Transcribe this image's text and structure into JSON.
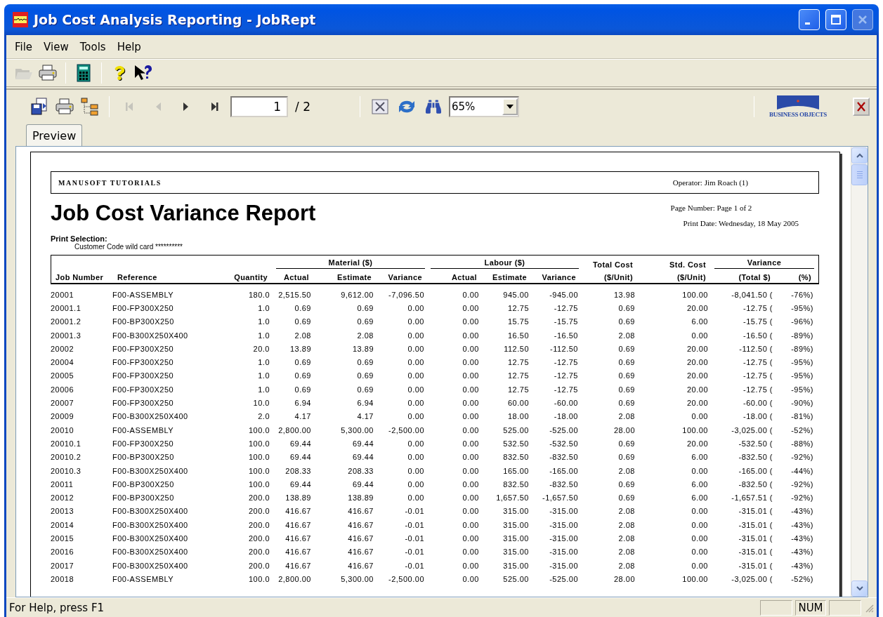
{
  "window": {
    "title": "Job Cost Analysis Reporting - JobRept",
    "controls": [
      {
        "kind": "minimize",
        "disabled": false
      },
      {
        "kind": "maximize",
        "disabled": false
      },
      {
        "kind": "close",
        "disabled": true
      }
    ]
  },
  "menu": [
    "File",
    "View",
    "Tools",
    "Help"
  ],
  "toolbar": [
    [
      {
        "kind": "open",
        "disabled": true
      },
      {
        "kind": "print",
        "disabled": false
      }
    ],
    [
      {
        "kind": "calculator",
        "disabled": false
      }
    ],
    [
      {
        "kind": "help",
        "disabled": false
      },
      {
        "kind": "context_help",
        "disabled": false
      }
    ]
  ],
  "report_toolbar": {
    "tools": [
      {
        "kind": "export",
        "disabled": false
      },
      {
        "kind": "print",
        "disabled": false
      },
      {
        "kind": "group_tree",
        "disabled": false
      }
    ],
    "navigation": [
      {
        "kind": "first",
        "disabled": true
      },
      {
        "kind": "prev",
        "disabled": true
      },
      {
        "kind": "next",
        "disabled": false
      },
      {
        "kind": "last",
        "disabled": false
      }
    ],
    "page_field": {
      "value": "1"
    },
    "page_total": "/ 2",
    "actions": [
      {
        "kind": "stop",
        "disabled": false
      },
      {
        "kind": "refresh",
        "disabled": false
      },
      {
        "kind": "search",
        "disabled": false
      }
    ],
    "zoom": {
      "value": "65%"
    },
    "logo_text": "BUSINESS OBJECTS"
  },
  "tabs": [
    {
      "label": "Preview",
      "selected": true
    }
  ],
  "report": {
    "company": "MANUSOFT TUTORIALS",
    "operator": "Operator: Jim Roach (1)",
    "title": "Job Cost Variance Report",
    "page_number": "Page Number: Page 1 of 2",
    "print_date": "Print Date: Wednesday, 18 May 2005",
    "print_selection_label": "Print Selection:",
    "print_selection": "Customer Code wild card **********",
    "header_groups": [
      {
        "kind": "single",
        "columns": [
          "Job Number"
        ]
      },
      {
        "kind": "single",
        "columns": [
          "Reference"
        ]
      },
      {
        "kind": "single",
        "columns": [
          "Quantity"
        ]
      },
      {
        "kind": "group",
        "label": "Material ($)",
        "columns": [
          "Actual",
          "Estimate",
          "Variance"
        ]
      },
      {
        "kind": "group",
        "label": "Labour ($)",
        "columns": [
          "Actual",
          "Estimate",
          "Variance"
        ]
      },
      {
        "kind": "stacked",
        "label": "Total Cost",
        "columns": [
          "($/Unit)"
        ]
      },
      {
        "kind": "stacked",
        "label": "Std. Cost",
        "columns": [
          "($/Unit)"
        ]
      },
      {
        "kind": "group",
        "label": "Variance",
        "columns": [
          "(Total $)",
          "(%)"
        ]
      }
    ],
    "rows": [
      [
        "20001",
        "F00-ASSEMBLY",
        "180.0",
        "2,515.50",
        "9,612.00",
        "-7,096.50",
        "0.00",
        "945.00",
        "-945.00",
        "13.98",
        "100.00",
        "-8,041.50 (",
        "-76%)"
      ],
      [
        "20001.1",
        "F00-FP300X250",
        "1.0",
        "0.69",
        "0.69",
        "0.00",
        "0.00",
        "12.75",
        "-12.75",
        "0.69",
        "20.00",
        "-12.75 (",
        "-95%)"
      ],
      [
        "20001.2",
        "F00-BP300X250",
        "1.0",
        "0.69",
        "0.69",
        "0.00",
        "0.00",
        "15.75",
        "-15.75",
        "0.69",
        "6.00",
        "-15.75 (",
        "-96%)"
      ],
      [
        "20001.3",
        "F00-B300X250X400",
        "1.0",
        "2.08",
        "2.08",
        "0.00",
        "0.00",
        "16.50",
        "-16.50",
        "2.08",
        "0.00",
        "-16.50 (",
        "-89%)"
      ],
      [
        "20002",
        "F00-FP300X250",
        "20.0",
        "13.89",
        "13.89",
        "0.00",
        "0.00",
        "112.50",
        "-112.50",
        "0.69",
        "20.00",
        "-112.50 (",
        "-89%)"
      ],
      [
        "20004",
        "F00-FP300X250",
        "1.0",
        "0.69",
        "0.69",
        "0.00",
        "0.00",
        "12.75",
        "-12.75",
        "0.69",
        "20.00",
        "-12.75 (",
        "-95%)"
      ],
      [
        "20005",
        "F00-FP300X250",
        "1.0",
        "0.69",
        "0.69",
        "0.00",
        "0.00",
        "12.75",
        "-12.75",
        "0.69",
        "20.00",
        "-12.75 (",
        "-95%)"
      ],
      [
        "20006",
        "F00-FP300X250",
        "1.0",
        "0.69",
        "0.69",
        "0.00",
        "0.00",
        "12.75",
        "-12.75",
        "0.69",
        "20.00",
        "-12.75 (",
        "-95%)"
      ],
      [
        "20007",
        "F00-FP300X250",
        "10.0",
        "6.94",
        "6.94",
        "0.00",
        "0.00",
        "60.00",
        "-60.00",
        "0.69",
        "20.00",
        "-60.00 (",
        "-90%)"
      ],
      [
        "20009",
        "F00-B300X250X400",
        "2.0",
        "4.17",
        "4.17",
        "0.00",
        "0.00",
        "18.00",
        "-18.00",
        "2.08",
        "0.00",
        "-18.00 (",
        "-81%)"
      ],
      [
        "20010",
        "F00-ASSEMBLY",
        "100.0",
        "2,800.00",
        "5,300.00",
        "-2,500.00",
        "0.00",
        "525.00",
        "-525.00",
        "28.00",
        "100.00",
        "-3,025.00 (",
        "-52%)"
      ],
      [
        "20010.1",
        "F00-FP300X250",
        "100.0",
        "69.44",
        "69.44",
        "0.00",
        "0.00",
        "532.50",
        "-532.50",
        "0.69",
        "20.00",
        "-532.50 (",
        "-88%)"
      ],
      [
        "20010.2",
        "F00-BP300X250",
        "100.0",
        "69.44",
        "69.44",
        "0.00",
        "0.00",
        "832.50",
        "-832.50",
        "0.69",
        "6.00",
        "-832.50 (",
        "-92%)"
      ],
      [
        "20010.3",
        "F00-B300X250X400",
        "100.0",
        "208.33",
        "208.33",
        "0.00",
        "0.00",
        "165.00",
        "-165.00",
        "2.08",
        "0.00",
        "-165.00 (",
        "-44%)"
      ],
      [
        "20011",
        "F00-BP300X250",
        "100.0",
        "69.44",
        "69.44",
        "0.00",
        "0.00",
        "832.50",
        "-832.50",
        "0.69",
        "6.00",
        "-832.50 (",
        "-92%)"
      ],
      [
        "20012",
        "F00-BP300X250",
        "200.0",
        "138.89",
        "138.89",
        "0.00",
        "0.00",
        "1,657.50",
        "-1,657.50",
        "0.69",
        "6.00",
        "-1,657.51 (",
        "-92%)"
      ],
      [
        "20013",
        "F00-B300X250X400",
        "200.0",
        "416.67",
        "416.67",
        "-0.01",
        "0.00",
        "315.00",
        "-315.00",
        "2.08",
        "0.00",
        "-315.01 (",
        "-43%)"
      ],
      [
        "20014",
        "F00-B300X250X400",
        "200.0",
        "416.67",
        "416.67",
        "-0.01",
        "0.00",
        "315.00",
        "-315.00",
        "2.08",
        "0.00",
        "-315.01 (",
        "-43%)"
      ],
      [
        "20015",
        "F00-B300X250X400",
        "200.0",
        "416.67",
        "416.67",
        "-0.01",
        "0.00",
        "315.00",
        "-315.00",
        "2.08",
        "0.00",
        "-315.01 (",
        "-43%)"
      ],
      [
        "20016",
        "F00-B300X250X400",
        "200.0",
        "416.67",
        "416.67",
        "-0.01",
        "0.00",
        "315.00",
        "-315.00",
        "2.08",
        "0.00",
        "-315.01 (",
        "-43%)"
      ],
      [
        "20017",
        "F00-B300X250X400",
        "200.0",
        "416.67",
        "416.67",
        "-0.01",
        "0.00",
        "315.00",
        "-315.00",
        "2.08",
        "0.00",
        "-315.01 (",
        "-43%)"
      ],
      [
        "20018",
        "F00-ASSEMBLY",
        "100.0",
        "2,800.00",
        "5,300.00",
        "-2,500.00",
        "0.00",
        "525.00",
        "-525.00",
        "28.00",
        "100.00",
        "-3,025.00 (",
        "-52%)"
      ]
    ]
  },
  "status_bar": {
    "help": "For Help, press F1",
    "num_indicator": "NUM"
  }
}
